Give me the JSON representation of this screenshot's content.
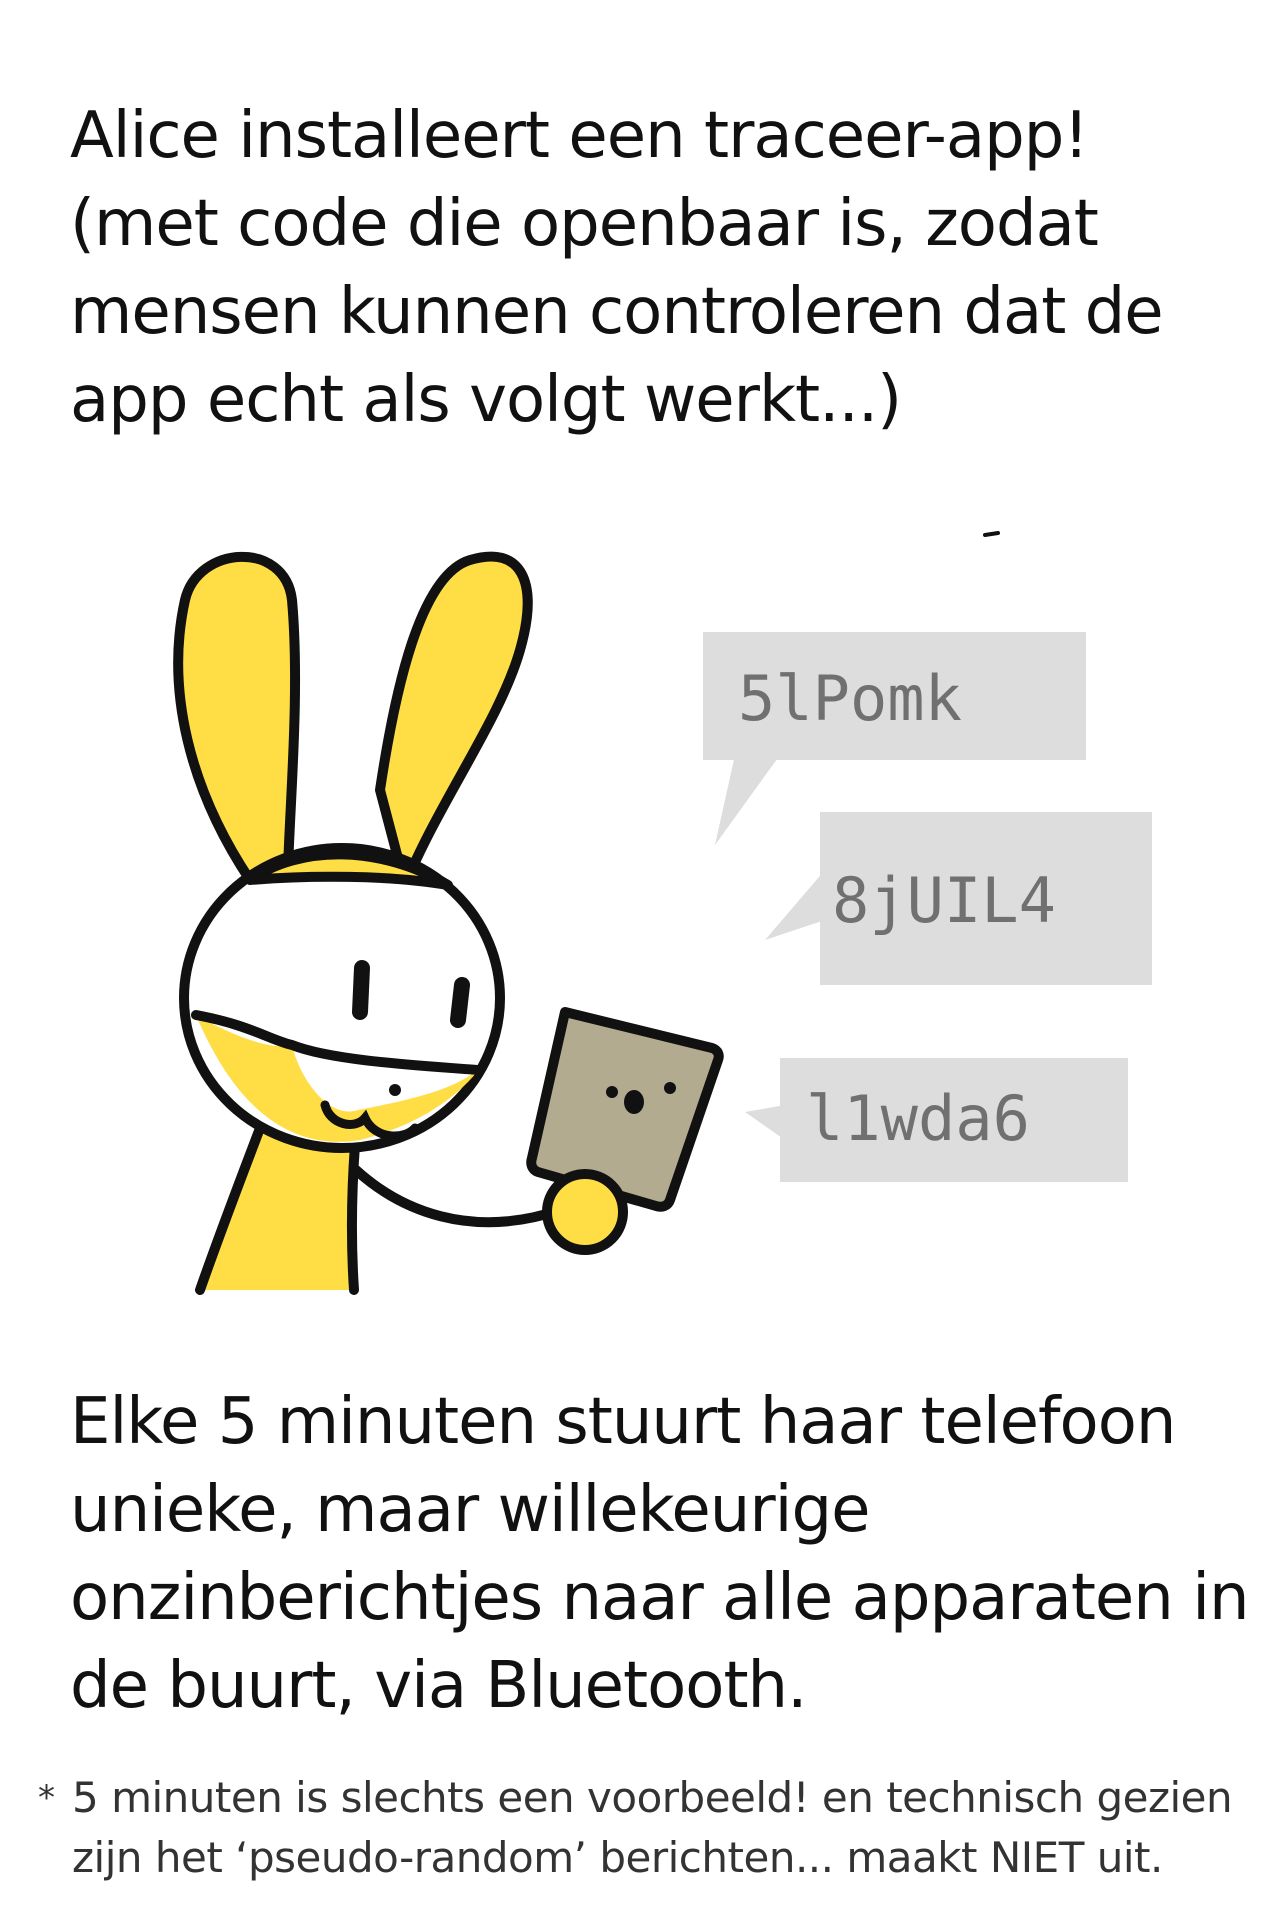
{
  "intro": {
    "lines": [
      "Alice installeert een traceer-app!",
      "(met code die openbaar is, zodat",
      "mensen kunnen controleren dat de",
      "app echt als volgt werkt...)"
    ]
  },
  "messages": [
    {
      "text": "5lPomk"
    },
    {
      "text": "8jUIL4"
    },
    {
      "text": "l1wda6"
    }
  ],
  "body": {
    "lines": [
      "Elke 5 minuten stuurt haar telefoon",
      "unieke, maar willekeurige",
      "onzinberichtjes naar alle apparaten in",
      "de buurt, via Bluetooth."
    ]
  },
  "footnote": {
    "marker": "*",
    "lines": [
      "5 minuten is slechts een voorbeeld! en technisch gezien",
      "zijn het ‘pseudo-random’ berichten... maakt NIET uit."
    ]
  },
  "colors": {
    "bunny_yellow": "#FFDD44",
    "outline": "#111111",
    "phone": "#B2AB90",
    "bubble": "#DDDDDD",
    "bubble_text": "#707070"
  }
}
